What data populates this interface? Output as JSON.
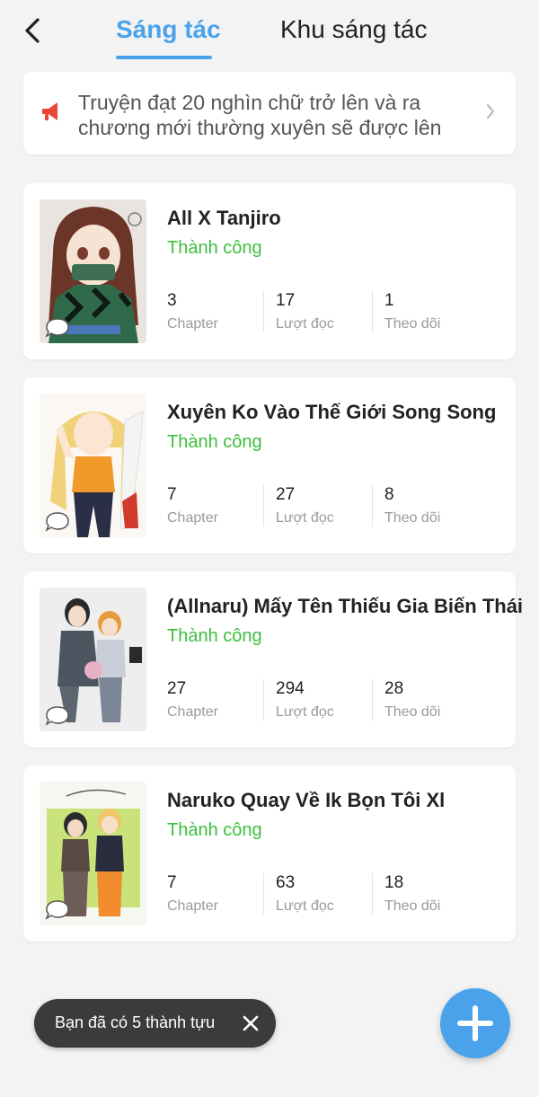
{
  "header": {
    "tabs": [
      {
        "label": "Sáng tác",
        "active": true
      },
      {
        "label": "Khu sáng tác",
        "active": false
      }
    ],
    "accent_color": "#4aa3ea"
  },
  "notice": {
    "icon": "megaphone-icon",
    "text": "Truyện đạt 20 nghìn chữ trở lên và ra chương mới thường xuyên sẽ được lên"
  },
  "stories": [
    {
      "title": "All X Tanjiro",
      "status": "Thành công",
      "stats": [
        {
          "value": "3",
          "label": "Chapter"
        },
        {
          "value": "17",
          "label": "Lượt đọc"
        },
        {
          "value": "1",
          "label": "Theo dõi"
        }
      ]
    },
    {
      "title": "Xuyên Ko Vào Thế Giới Song Song",
      "status": "Thành công",
      "stats": [
        {
          "value": "7",
          "label": "Chapter"
        },
        {
          "value": "27",
          "label": "Lượt đọc"
        },
        {
          "value": "8",
          "label": "Theo dõi"
        }
      ]
    },
    {
      "title": "(Allnaru) Mấy Tên Thiếu Gia Biến Thái",
      "status": "Thành công",
      "stats": [
        {
          "value": "27",
          "label": "Chapter"
        },
        {
          "value": "294",
          "label": "Lượt đọc"
        },
        {
          "value": "28",
          "label": "Theo dõi"
        }
      ]
    },
    {
      "title": "Naruko Quay Về Ik Bọn Tôi Xl",
      "status": "Thành công",
      "stats": [
        {
          "value": "7",
          "label": "Chapter"
        },
        {
          "value": "63",
          "label": "Lượt đọc"
        },
        {
          "value": "18",
          "label": "Theo dõi"
        }
      ]
    }
  ],
  "toast": {
    "text": "Bạn đã có 5 thành tựu"
  },
  "fab": {
    "icon": "plus-icon"
  },
  "status_color": "#3cbf3c"
}
